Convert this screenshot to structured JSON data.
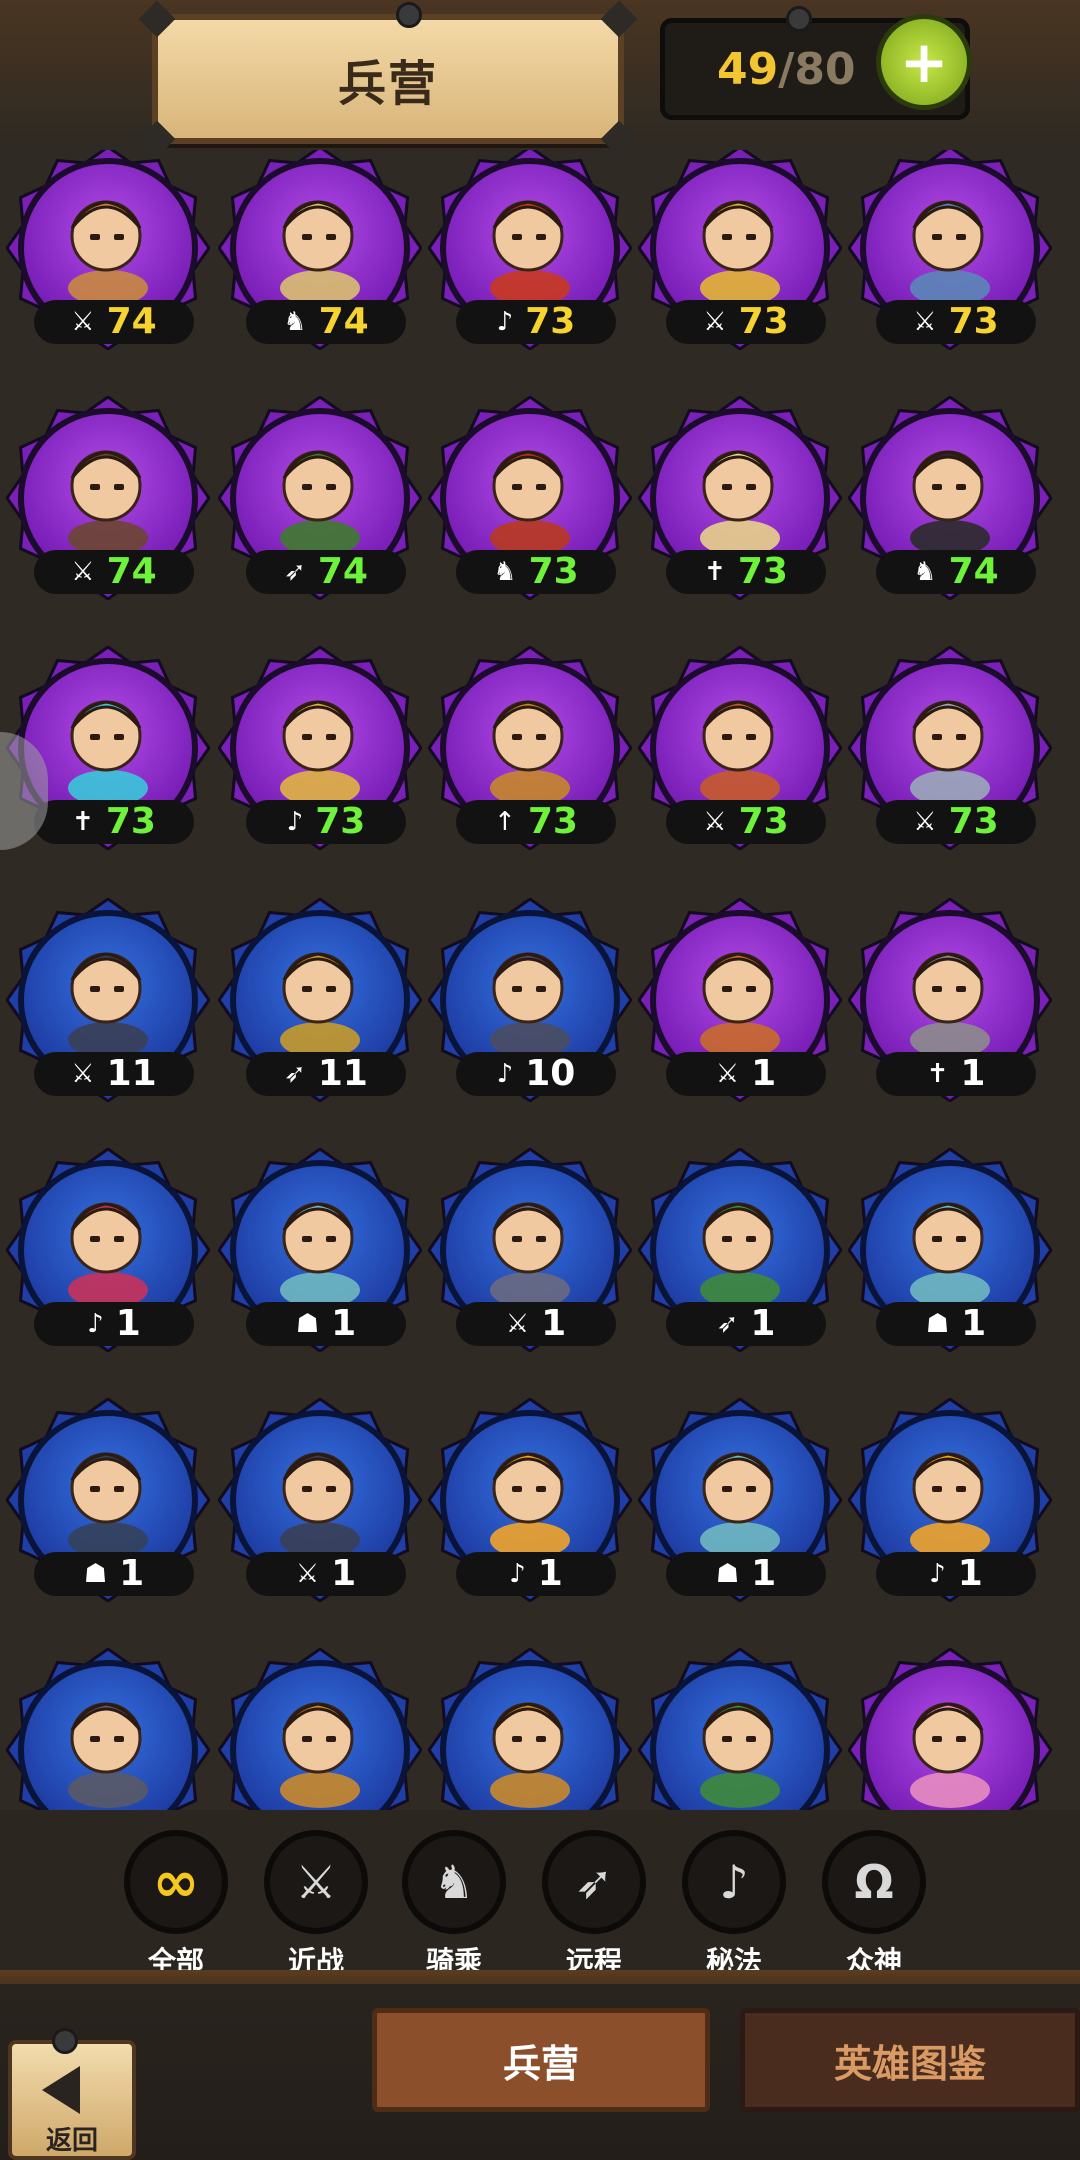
{
  "header": {
    "title": "兵营",
    "capacity_current": "49",
    "capacity_sep": "/",
    "capacity_max": "80",
    "plus_label": "+"
  },
  "class_icons": {
    "melee": "sword-icon",
    "cavalry": "horse-icon",
    "ranged": "bow-icon",
    "mystic": "harp-icon",
    "holy": "ankh-icon",
    "spear": "spear-icon",
    "mask": "mask-icon"
  },
  "units": [
    {
      "row": 0,
      "col": 0,
      "frame": "purple",
      "class": "sword",
      "level": "74",
      "color": "gold",
      "hue": "#c9883f"
    },
    {
      "row": 0,
      "col": 1,
      "frame": "purple",
      "class": "horse",
      "level": "74",
      "color": "gold",
      "hue": "#d9c070"
    },
    {
      "row": 0,
      "col": 2,
      "frame": "purple",
      "class": "harp",
      "level": "73",
      "color": "gold",
      "hue": "#c8381f"
    },
    {
      "row": 0,
      "col": 3,
      "frame": "purple",
      "class": "sword",
      "level": "73",
      "color": "gold",
      "hue": "#e2b534"
    },
    {
      "row": 0,
      "col": 4,
      "frame": "purple",
      "class": "sword",
      "level": "73",
      "color": "gold",
      "hue": "#5b86b8"
    },
    {
      "row": 1,
      "col": 0,
      "frame": "purple",
      "class": "sword",
      "level": "74",
      "color": "green",
      "hue": "#6b4630"
    },
    {
      "row": 1,
      "col": 1,
      "frame": "purple",
      "class": "bow",
      "level": "74",
      "color": "green",
      "hue": "#3f7a2e"
    },
    {
      "row": 1,
      "col": 2,
      "frame": "purple",
      "class": "horse",
      "level": "73",
      "color": "green",
      "hue": "#b8381f"
    },
    {
      "row": 1,
      "col": 3,
      "frame": "purple",
      "class": "ankh",
      "level": "73",
      "color": "green",
      "hue": "#e8d28a"
    },
    {
      "row": 1,
      "col": 4,
      "frame": "purple",
      "class": "horse",
      "level": "74",
      "color": "green",
      "hue": "#2b2b2b"
    },
    {
      "row": 2,
      "col": 0,
      "frame": "purple",
      "class": "ankh",
      "level": "73",
      "color": "green",
      "hue": "#3ac6d9"
    },
    {
      "row": 2,
      "col": 1,
      "frame": "purple",
      "class": "harp",
      "level": "73",
      "color": "green",
      "hue": "#e0b440"
    },
    {
      "row": 2,
      "col": 2,
      "frame": "purple",
      "class": "spear",
      "level": "73",
      "color": "green",
      "hue": "#c7862a"
    },
    {
      "row": 2,
      "col": 3,
      "frame": "purple",
      "class": "sword",
      "level": "73",
      "color": "green",
      "hue": "#c65a2a"
    },
    {
      "row": 2,
      "col": 4,
      "frame": "purple",
      "class": "sword",
      "level": "73",
      "color": "green",
      "hue": "#9aa8b8"
    },
    {
      "row": 3,
      "col": 0,
      "frame": "blue",
      "class": "sword",
      "level": "11",
      "color": "white",
      "hue": "#3a3f55"
    },
    {
      "row": 3,
      "col": 1,
      "frame": "blue",
      "class": "bow",
      "level": "11",
      "color": "white",
      "hue": "#c79a2a"
    },
    {
      "row": 3,
      "col": 2,
      "frame": "blue",
      "class": "harp",
      "level": "10",
      "color": "white",
      "hue": "#4a4d60"
    },
    {
      "row": 3,
      "col": 3,
      "frame": "purple",
      "class": "sword",
      "level": "1",
      "color": "white",
      "hue": "#c96a2a"
    },
    {
      "row": 3,
      "col": 4,
      "frame": "purple",
      "class": "ankh",
      "level": "1",
      "color": "white",
      "hue": "#8c8c8c"
    },
    {
      "row": 4,
      "col": 0,
      "frame": "blue",
      "class": "harp",
      "level": "1",
      "color": "white",
      "hue": "#c8325a"
    },
    {
      "row": 4,
      "col": 1,
      "frame": "blue",
      "class": "mask",
      "level": "1",
      "color": "white",
      "hue": "#6fb8c0"
    },
    {
      "row": 4,
      "col": 2,
      "frame": "blue",
      "class": "sword",
      "level": "1",
      "color": "white",
      "hue": "#6a6a80"
    },
    {
      "row": 4,
      "col": 3,
      "frame": "blue",
      "class": "bow",
      "level": "1",
      "color": "white",
      "hue": "#3e8a3a"
    },
    {
      "row": 4,
      "col": 4,
      "frame": "blue",
      "class": "mask",
      "level": "1",
      "color": "white",
      "hue": "#6fb8c0"
    },
    {
      "row": 5,
      "col": 0,
      "frame": "blue",
      "class": "mask",
      "level": "1",
      "color": "white",
      "hue": "#34415a"
    },
    {
      "row": 5,
      "col": 1,
      "frame": "blue",
      "class": "sword",
      "level": "1",
      "color": "white",
      "hue": "#3a3f55"
    },
    {
      "row": 5,
      "col": 2,
      "frame": "blue",
      "class": "harp",
      "level": "1",
      "color": "white",
      "hue": "#f0a42a"
    },
    {
      "row": 5,
      "col": 3,
      "frame": "blue",
      "class": "mask",
      "level": "1",
      "color": "white",
      "hue": "#6fb8c0"
    },
    {
      "row": 5,
      "col": 4,
      "frame": "blue",
      "class": "harp",
      "level": "1",
      "color": "white",
      "hue": "#f0a42a"
    },
    {
      "row": 6,
      "col": 0,
      "frame": "blue",
      "class": "none",
      "level": "",
      "color": "white",
      "hue": "#5a5a66"
    },
    {
      "row": 6,
      "col": 1,
      "frame": "blue",
      "class": "none",
      "level": "",
      "color": "white",
      "hue": "#c98a2a"
    },
    {
      "row": 6,
      "col": 2,
      "frame": "blue",
      "class": "none",
      "level": "",
      "color": "white",
      "hue": "#c98a2a"
    },
    {
      "row": 6,
      "col": 3,
      "frame": "blue",
      "class": "none",
      "level": "",
      "color": "white",
      "hue": "#3e8a3a"
    },
    {
      "row": 6,
      "col": 4,
      "frame": "purple",
      "class": "none",
      "level": "",
      "color": "white",
      "hue": "#e88cc0"
    }
  ],
  "filters": [
    {
      "key": "all",
      "icon": "∞",
      "label": "全部",
      "active": true
    },
    {
      "key": "melee",
      "icon": "⚔",
      "label": "近战",
      "active": false
    },
    {
      "key": "cavalry",
      "icon": "♞",
      "label": "骑乘",
      "active": false
    },
    {
      "key": "ranged",
      "icon": "➶",
      "label": "远程",
      "active": false
    },
    {
      "key": "mystic",
      "icon": "♪",
      "label": "秘法",
      "active": false
    },
    {
      "key": "pantheon",
      "icon": "Ω",
      "label": "众神",
      "active": false
    }
  ],
  "footer": {
    "back_label": "返回",
    "tab_barracks": "兵营",
    "tab_codex": "英雄图鉴"
  },
  "colors": {
    "gold_level": "#f7d330",
    "green_level": "#6ff23a",
    "purple_frame": "#7a1fb8",
    "blue_frame": "#1f3fa6"
  }
}
